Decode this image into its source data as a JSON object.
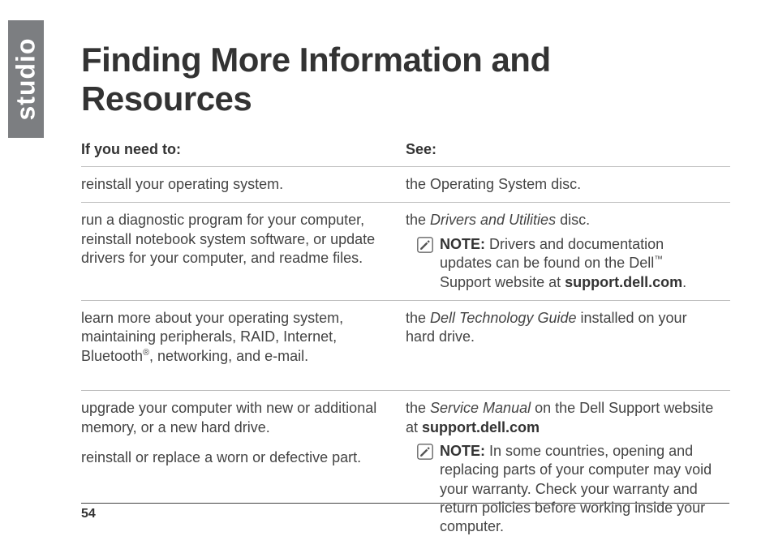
{
  "brand_tab": "studio",
  "title": "Finding More Information and Resources",
  "table": {
    "header_left": "If you need to:",
    "header_right": "See:",
    "rows": [
      {
        "need": "reinstall your operating system.",
        "see_plain": "the Operating System disc."
      },
      {
        "need": "run a diagnostic program for your computer, reinstall notebook system software, or update drivers for your computer, and readme files.",
        "see_prefix": "the ",
        "see_italic": "Drivers and Utilities",
        "see_suffix": " disc.",
        "note": {
          "label": "NOTE:",
          "before_tm": " Drivers and documentation updates can be found on the Dell",
          "tm": "™",
          "after_tm": " Support website at ",
          "bold_link": "support.dell.com",
          "end": "."
        }
      },
      {
        "need_before_r": "learn more about your operating system, maintaining peripherals, RAID, Internet, Bluetooth",
        "r_mark": "®",
        "need_after_r": ", networking, and e-mail.",
        "see_prefix": "the ",
        "see_italic": "Dell Technology Guide",
        "see_suffix": " installed on your hard drive."
      },
      {
        "need_line1": "upgrade your computer with new or additional memory, or a new hard drive.",
        "need_line2": "reinstall or replace a worn or defective part.",
        "see_prefix": "the ",
        "see_italic": "Service Manual",
        "see_mid": " on the Dell Support website at ",
        "see_bold": "support.dell.com",
        "note": {
          "label": "NOTE:",
          "body": " In some countries, opening and replacing parts of your computer may void your warranty. Check your warranty and return policies before working inside your computer."
        }
      }
    ]
  },
  "page_number": "54"
}
